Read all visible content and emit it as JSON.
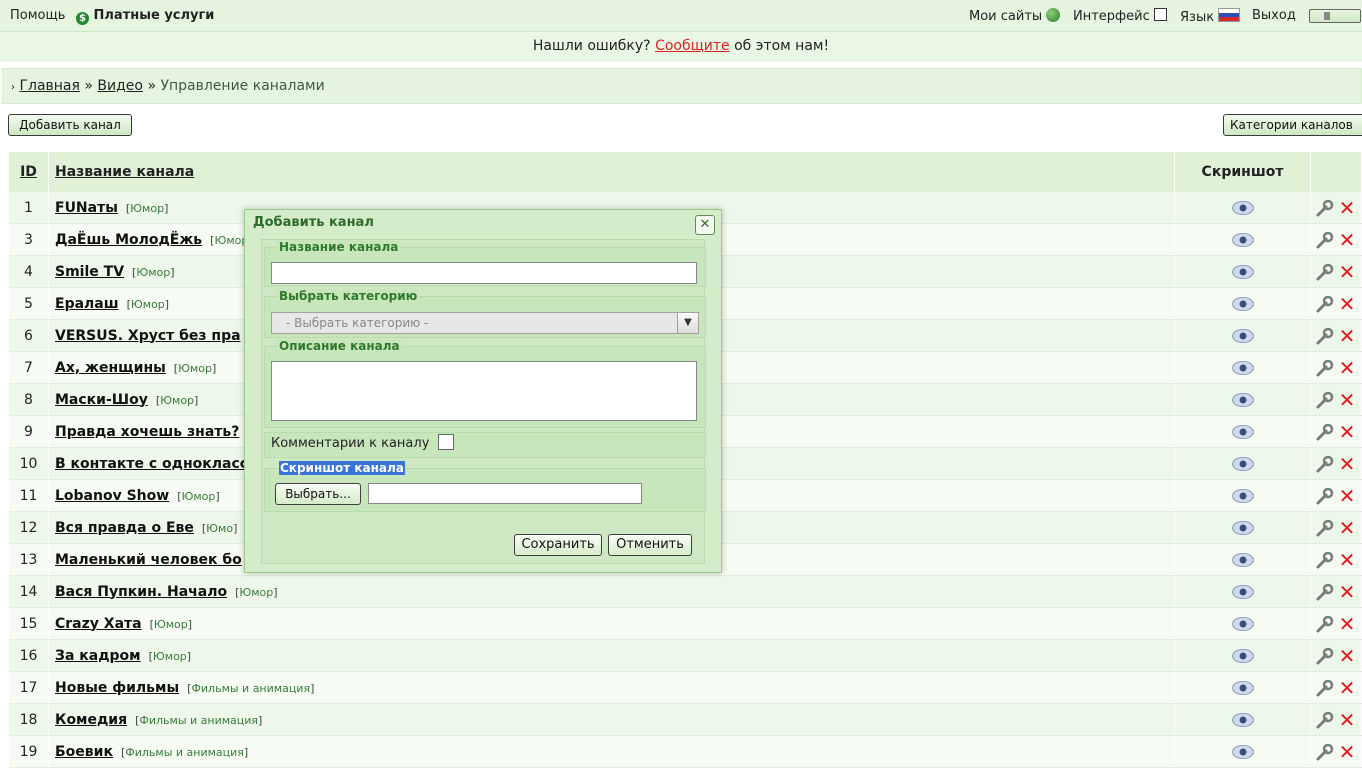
{
  "topbar": {
    "help": "Помощь",
    "paid": "Платные услуги",
    "my_sites": "Мои сайты",
    "interface": "Интерфейс",
    "language": "Язык",
    "logout": "Выход"
  },
  "notice": {
    "before": "Нашли ошибку?",
    "link": "Сообщите",
    "after": "об этом нам!"
  },
  "breadcrumb": {
    "home": "Главная",
    "video": "Видео",
    "current": "Управление каналами",
    "sep": "»"
  },
  "toolbar": {
    "add_channel": "Добавить канал",
    "categories": "Категории каналов"
  },
  "table": {
    "col_id": "ID",
    "col_name": "Название канала",
    "col_screenshot": "Скриншот",
    "rows": [
      {
        "id": "1",
        "name": "FUNаты",
        "category": "Юмор"
      },
      {
        "id": "3",
        "name": "ДаЁшь МолодЁжь",
        "category": "Юмор"
      },
      {
        "id": "4",
        "name": "Smile TV",
        "category": "Юмор"
      },
      {
        "id": "5",
        "name": "Ералаш",
        "category": "Юмор"
      },
      {
        "id": "6",
        "name": "VERSUS. Хруст без пра",
        "category": ""
      },
      {
        "id": "7",
        "name": "Ах, женщины",
        "category": "Юмор"
      },
      {
        "id": "8",
        "name": "Маски-Шоу",
        "category": "Юмор"
      },
      {
        "id": "9",
        "name": "Правда хочешь знать?",
        "category": ""
      },
      {
        "id": "10",
        "name": "В контакте с однокласс",
        "category": ""
      },
      {
        "id": "11",
        "name": "Lobanov Show",
        "category": "Юмор"
      },
      {
        "id": "12",
        "name": "Вся правда о Еве",
        "category": "Юмо"
      },
      {
        "id": "13",
        "name": "Маленький человек бо",
        "category": ""
      },
      {
        "id": "14",
        "name": "Вася Пупкин. Начало",
        "category": "Юмор"
      },
      {
        "id": "15",
        "name": "Crazy Хата",
        "category": "Юмор"
      },
      {
        "id": "16",
        "name": "За кадром",
        "category": "Юмор"
      },
      {
        "id": "17",
        "name": "Новые фильмы",
        "category": "Фильмы и анимация"
      },
      {
        "id": "18",
        "name": "Комедия",
        "category": "Фильмы и анимация"
      },
      {
        "id": "19",
        "name": "Боевик",
        "category": "Фильмы и анимация"
      }
    ]
  },
  "dialog": {
    "title": "Добавить канал",
    "name_legend": "Название канала",
    "name_value": "",
    "category_legend": "Выбрать категорию",
    "category_selected": "- Выбрать категорию -",
    "description_legend": "Описание канала",
    "description_value": "",
    "comments_label": "Комментарии к каналу",
    "screenshot_legend": "Скриншот канала",
    "browse": "Выбрать...",
    "file_value": "",
    "save": "Сохранить",
    "cancel": "Отменить"
  }
}
